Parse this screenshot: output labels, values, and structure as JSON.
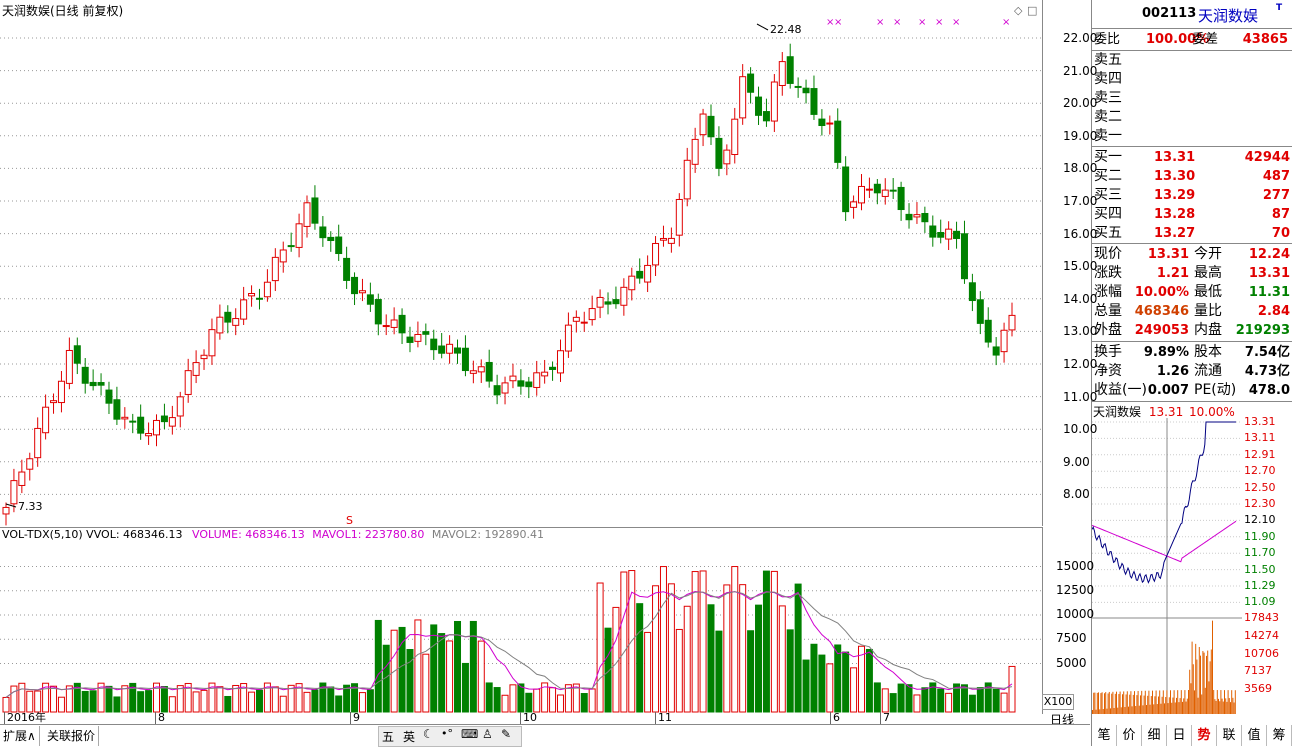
{
  "main": {
    "title": "天润数娱(日线 前复权)",
    "high_marker": "22.48",
    "low_marker": "7.33",
    "y_ticks": [
      "22.00",
      "21.00",
      "20.00",
      "19.00",
      "18.00",
      "17.00",
      "16.00",
      "15.00",
      "14.00",
      "13.00",
      "12.00",
      "11.00",
      "10.00",
      "9.00",
      "8.00"
    ],
    "s_marker": "S",
    "x_marks": "×"
  },
  "volume": {
    "title_prefix": "VOL-TDX(5,10) VVOL: 468346.13",
    "volume_label": "VOLUME: 468346.13",
    "mavol1_label": "MAVOL1: 223780.80",
    "mavol2_label": "MAVOL2: 192890.41",
    "y_ticks": [
      "15000",
      "12500",
      "10000",
      "7500",
      "5000"
    ],
    "multiplier": "X100"
  },
  "date_axis": {
    "labels": [
      "2016年",
      "8",
      "9",
      "10",
      "11",
      "6",
      "7"
    ],
    "right_label": "日线"
  },
  "bottom_tabs": [
    "扩展∧",
    "关联报价"
  ],
  "toolbar_icons": [
    "五",
    "英"
  ],
  "quote": {
    "code": "002113",
    "name": "天润数娱",
    "t_badge": "T",
    "weibi_label": "委比",
    "weibi": "100.00%",
    "weicha_label": "委差",
    "weicha": "43865",
    "sell": [
      {
        "label": "卖五",
        "price": "",
        "vol": ""
      },
      {
        "label": "卖四",
        "price": "",
        "vol": ""
      },
      {
        "label": "卖三",
        "price": "",
        "vol": ""
      },
      {
        "label": "卖二",
        "price": "",
        "vol": ""
      },
      {
        "label": "卖一",
        "price": "",
        "vol": ""
      }
    ],
    "buy": [
      {
        "label": "买一",
        "price": "13.31",
        "vol": "42944"
      },
      {
        "label": "买二",
        "price": "13.30",
        "vol": "487"
      },
      {
        "label": "买三",
        "price": "13.29",
        "vol": "277"
      },
      {
        "label": "买四",
        "price": "13.28",
        "vol": "87"
      },
      {
        "label": "买五",
        "price": "13.27",
        "vol": "70"
      }
    ],
    "stats": [
      {
        "l1": "现价",
        "v1": "13.31",
        "c1": "red",
        "l2": "今开",
        "v2": "12.24",
        "c2": "red"
      },
      {
        "l1": "涨跌",
        "v1": "1.21",
        "c1": "red",
        "l2": "最高",
        "v2": "13.31",
        "c2": "red"
      },
      {
        "l1": "涨幅",
        "v1": "10.00%",
        "c1": "red",
        "l2": "最低",
        "v2": "11.31",
        "c2": "green"
      },
      {
        "l1": "总量",
        "v1": "468346",
        "c1": "orange",
        "l2": "量比",
        "v2": "2.84",
        "c2": "red"
      },
      {
        "l1": "外盘",
        "v1": "249053",
        "c1": "red",
        "l2": "内盘",
        "v2": "219293",
        "c2": "green"
      }
    ],
    "stats2": [
      {
        "l1": "换手",
        "v1": "9.89%",
        "l2": "股本",
        "v2": "7.54亿"
      },
      {
        "l1": "净资",
        "v1": "1.26",
        "l2": "流通",
        "v2": "4.73亿"
      },
      {
        "l1": "收益(一)",
        "v1": "0.007",
        "l2": "PE(动)",
        "v2": "478.0"
      }
    ]
  },
  "intraday": {
    "name": "天润数娱",
    "price": "13.31",
    "pct": "10.00%",
    "price_ticks": [
      "13.31",
      "13.11",
      "12.91",
      "12.70",
      "12.50",
      "12.30",
      "12.10",
      "11.90",
      "11.70",
      "11.50",
      "11.29",
      "11.09"
    ],
    "vol_ticks": [
      "17843",
      "14274",
      "10706",
      "7137",
      "3569"
    ]
  },
  "right_tabs": [
    "笔",
    "价",
    "细",
    "日",
    "势",
    "联",
    "值",
    "筹"
  ],
  "colors": {
    "up": "#e00000",
    "down": "#008000",
    "ma1": "#d000d0",
    "ma2": "#808080"
  }
}
